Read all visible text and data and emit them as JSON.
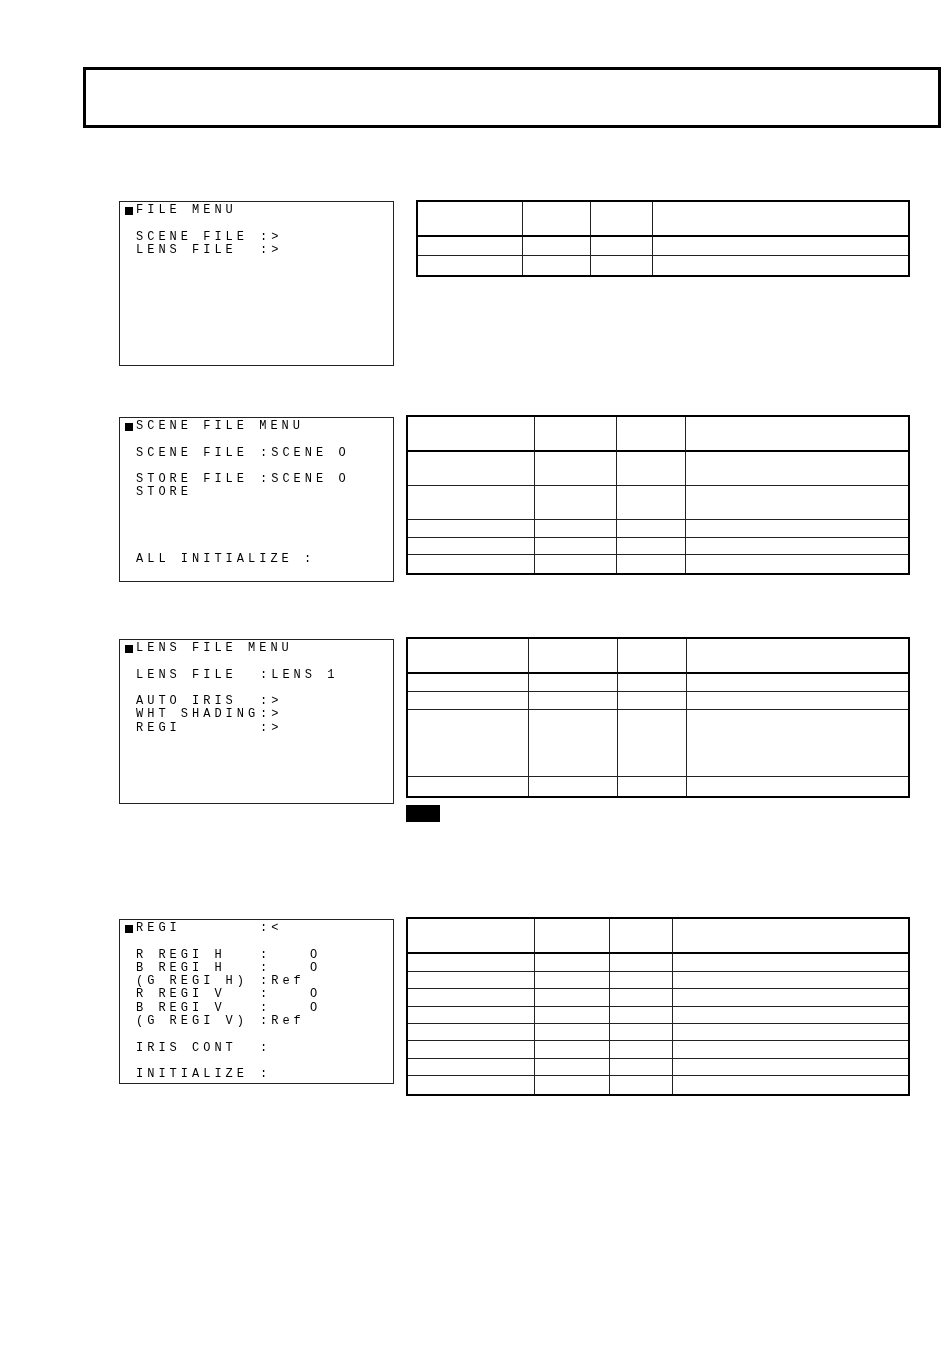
{
  "menus": [
    {
      "title": "FILE MENU",
      "lines": [
        {
          "label": "SCENE FILE",
          "value": ":>"
        },
        {
          "label": "LENS FILE",
          "value": ":>"
        }
      ]
    },
    {
      "title": "SCENE FILE MENU",
      "lines": [
        {
          "label": "SCENE FILE",
          "value": ":SCENE O"
        },
        {
          "label": "STORE FILE",
          "value": ":SCENE O"
        },
        {
          "label": "STORE"
        },
        {
          "label": "ALL INITIALIZE :"
        }
      ]
    },
    {
      "title": "LENS FILE MENU",
      "lines": [
        {
          "label": "LENS FILE",
          "value": ":LENS 1"
        },
        {
          "label": "AUTO IRIS",
          "value": ":>"
        },
        {
          "label": "WHT SHADING",
          "value": ":>"
        },
        {
          "label": "REGI",
          "value": ":>"
        }
      ]
    },
    {
      "title": "REGI",
      "title_value": ":<",
      "lines": [
        {
          "label": "R REGI H",
          "value": ":",
          "reading": "O"
        },
        {
          "label": "B REGI H",
          "value": ":",
          "reading": "O"
        },
        {
          "label": "(G REGI H)",
          "value": ":Ref"
        },
        {
          "label": "R REGI V",
          "value": ":",
          "reading": "O"
        },
        {
          "label": "B REGI V",
          "value": ":",
          "reading": "O"
        },
        {
          "label": "(G REGI V)",
          "value": ":Ref"
        },
        {
          "label": "IRIS CONT",
          "value": ":"
        },
        {
          "label": "INITIALIZE",
          "value": ":"
        }
      ]
    }
  ]
}
